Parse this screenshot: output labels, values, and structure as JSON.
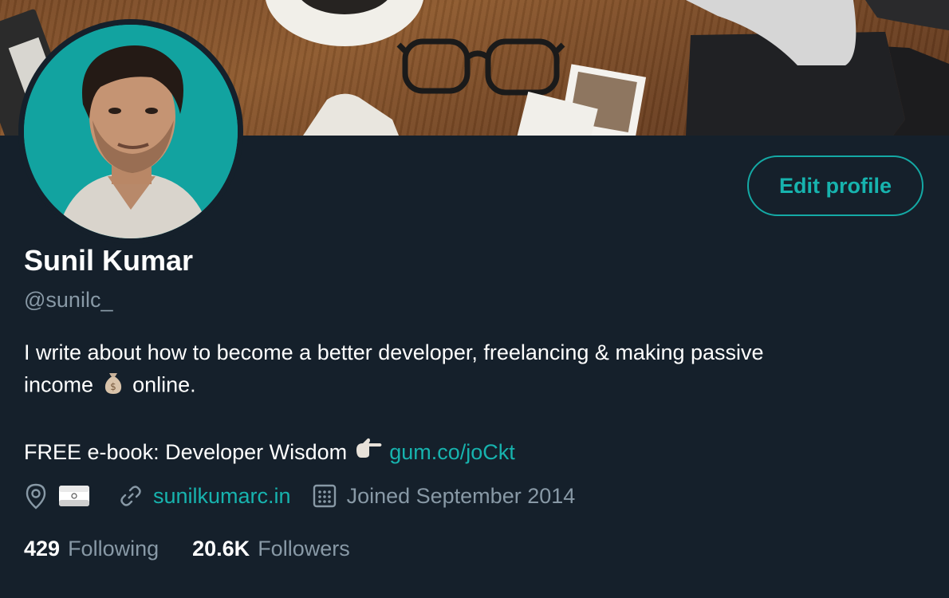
{
  "profile": {
    "name": "Sunil Kumar",
    "handle": "@sunilc_",
    "edit_button_label": "Edit profile",
    "bio": {
      "line1": "I write about how to become a better developer, freelancing & making passive",
      "line2_before": "income",
      "line2_after": "online.",
      "line3_before": "FREE e-book: Developer Wisdom",
      "line3_link": "gum.co/joCkt"
    },
    "meta": {
      "website": "sunilkumarc.in",
      "joined": "Joined September 2014"
    },
    "stats": {
      "following_count": "429",
      "following_label": "Following",
      "followers_count": "20.6K",
      "followers_label": "Followers"
    }
  },
  "colors": {
    "background": "#15202b",
    "accent": "#17b3ae",
    "secondary_text": "#8899a6",
    "avatar_bg": "#12a3a0"
  },
  "icons": [
    "location-icon",
    "india-flag-icon",
    "link-icon",
    "calendar-icon",
    "money-bag-emoji",
    "pointing-hand-emoji"
  ]
}
